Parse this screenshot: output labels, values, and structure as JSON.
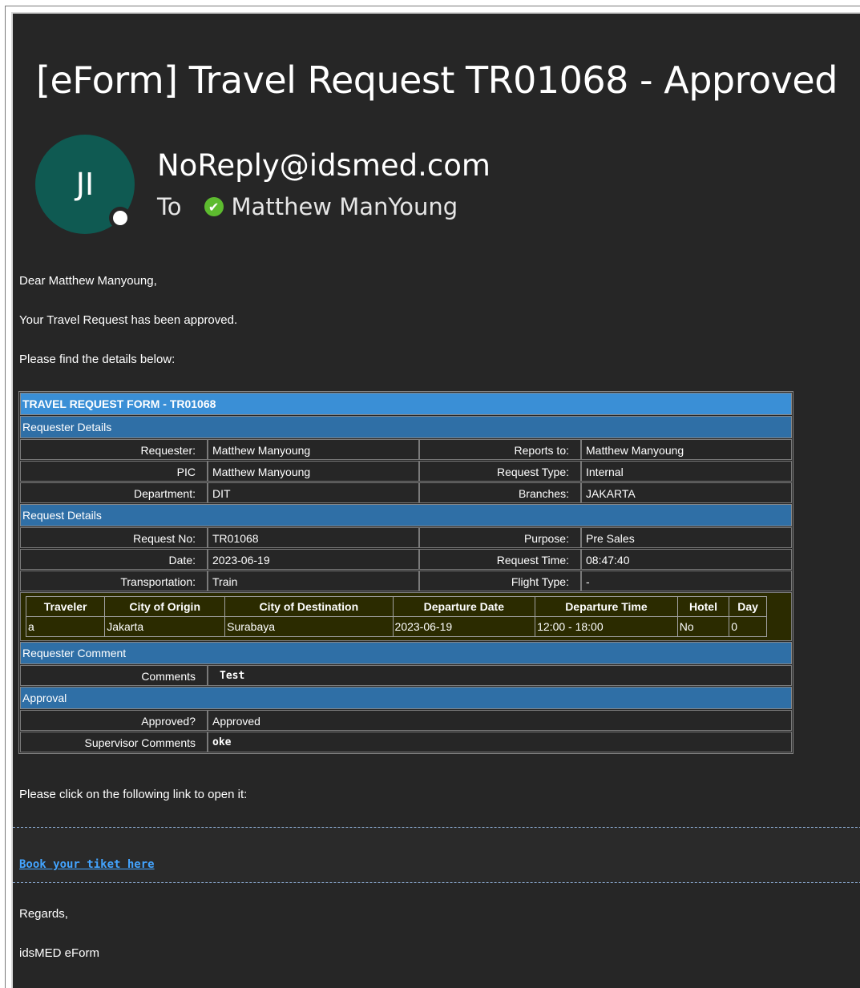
{
  "subject": "[eForm] Travel Request TR01068 - Approved",
  "avatar_initials": "JI",
  "sender": "NoReply@idsmed.com",
  "to_label": "To",
  "recipient": "Matthew ManYoung",
  "greeting": "Dear Matthew Manyoung,",
  "line1": "Your Travel Request has been approved.",
  "line2": "Please find the details below:",
  "form": {
    "title": "TRAVEL REQUEST FORM - TR01068",
    "requester_section": "Requester Details",
    "requester_label": "Requester:",
    "requester_value": "Matthew Manyoung",
    "reports_label": "Reports to:",
    "reports_value": "Matthew Manyoung",
    "pic_label": "PIC",
    "pic_value": "Matthew Manyoung",
    "reqtype_label": "Request Type:",
    "reqtype_value": "Internal",
    "dept_label": "Department:",
    "dept_value": "DIT",
    "branches_label": "Branches:",
    "branches_value": "JAKARTA",
    "request_section": "Request Details",
    "reqno_label": "Request No:",
    "reqno_value": "TR01068",
    "purpose_label": "Purpose:",
    "purpose_value": "Pre Sales",
    "date_label": "Date:",
    "date_value": "2023-06-19",
    "reqtime_label": "Request Time:",
    "reqtime_value": "08:47:40",
    "transport_label": "Transportation:",
    "transport_value": "Train",
    "flight_label": "Flight Type:",
    "flight_value": "-",
    "travel_headers": [
      "Traveler",
      "City of Origin",
      "City of Destination",
      "Departure Date",
      "Departure Time",
      "Hotel",
      "Day"
    ],
    "travel_row": [
      "a",
      "Jakarta",
      "Surabaya",
      "2023-06-19",
      "12:00 - 18:00",
      "No",
      "0"
    ],
    "comment_section": "Requester Comment",
    "comments_label": "Comments",
    "comments_value": "Test",
    "approval_section": "Approval",
    "approved_label": "Approved?",
    "approved_value": "Approved",
    "supervisor_label": "Supervisor Comments",
    "supervisor_value": "oke"
  },
  "link_intro": "Please click on the following link to open it:",
  "link_text": "Book your tiket here",
  "regards": "Regards,",
  "signature": "idsMED eForm",
  "colors": {
    "background": "#262626",
    "title_bar": "#3a8fd6",
    "section_bar": "#2f6fa6",
    "link": "#43a4ff",
    "avatar": "#0f5a52",
    "presence_ok": "#5dbb2f"
  }
}
